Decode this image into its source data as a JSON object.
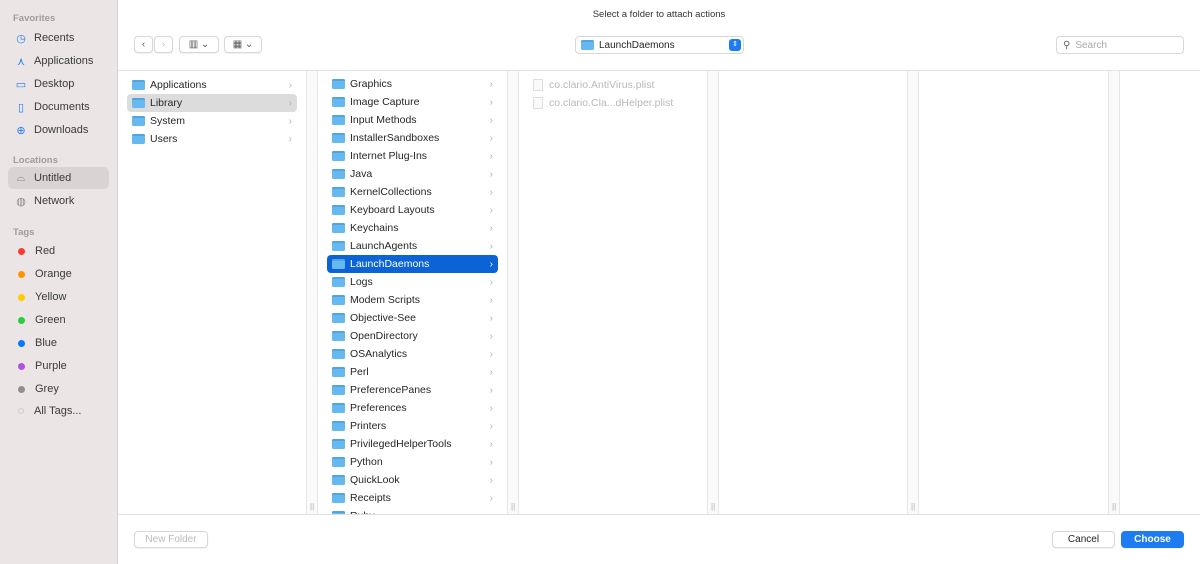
{
  "window_title": "Select a folder to attach actions",
  "sidebar": {
    "favorites_label": "Favorites",
    "favorites": [
      {
        "label": "Recents",
        "icon": "clock-icon"
      },
      {
        "label": "Applications",
        "icon": "applications-icon"
      },
      {
        "label": "Desktop",
        "icon": "desktop-icon"
      },
      {
        "label": "Documents",
        "icon": "document-icon"
      },
      {
        "label": "Downloads",
        "icon": "download-icon"
      }
    ],
    "locations_label": "Locations",
    "locations": [
      {
        "label": "Untitled",
        "icon": "drive-icon"
      },
      {
        "label": "Network",
        "icon": "globe-icon"
      }
    ],
    "tags_label": "Tags",
    "tags": [
      {
        "label": "Red",
        "color": "#fe3b30"
      },
      {
        "label": "Orange",
        "color": "#fe9500"
      },
      {
        "label": "Yellow",
        "color": "#fecc00"
      },
      {
        "label": "Green",
        "color": "#28cd41"
      },
      {
        "label": "Blue",
        "color": "#007aff"
      },
      {
        "label": "Purple",
        "color": "#af52de"
      },
      {
        "label": "Grey",
        "color": "#8e8e93"
      }
    ],
    "all_tags": "All Tags..."
  },
  "toolbar": {
    "path": "LaunchDaemons",
    "search_placeholder": "Search"
  },
  "columns": {
    "col1": [
      "Applications",
      "Library",
      "System",
      "Users"
    ],
    "col2": [
      "Graphics",
      "Image Capture",
      "Input Methods",
      "InstallerSandboxes",
      "Internet Plug-Ins",
      "Java",
      "KernelCollections",
      "Keyboard Layouts",
      "Keychains",
      "LaunchAgents",
      "LaunchDaemons",
      "Logs",
      "Modem Scripts",
      "Objective-See",
      "OpenDirectory",
      "OSAnalytics",
      "Perl",
      "PreferencePanes",
      "Preferences",
      "Printers",
      "PrivilegedHelperTools",
      "Python",
      "QuickLook",
      "Receipts",
      "Ruby"
    ],
    "col3": [
      "co.clario.AntiVirus.plist",
      "co.clario.Cla...dHelper.plist"
    ]
  },
  "footer": {
    "new_folder": "New Folder",
    "cancel": "Cancel",
    "choose": "Choose"
  }
}
